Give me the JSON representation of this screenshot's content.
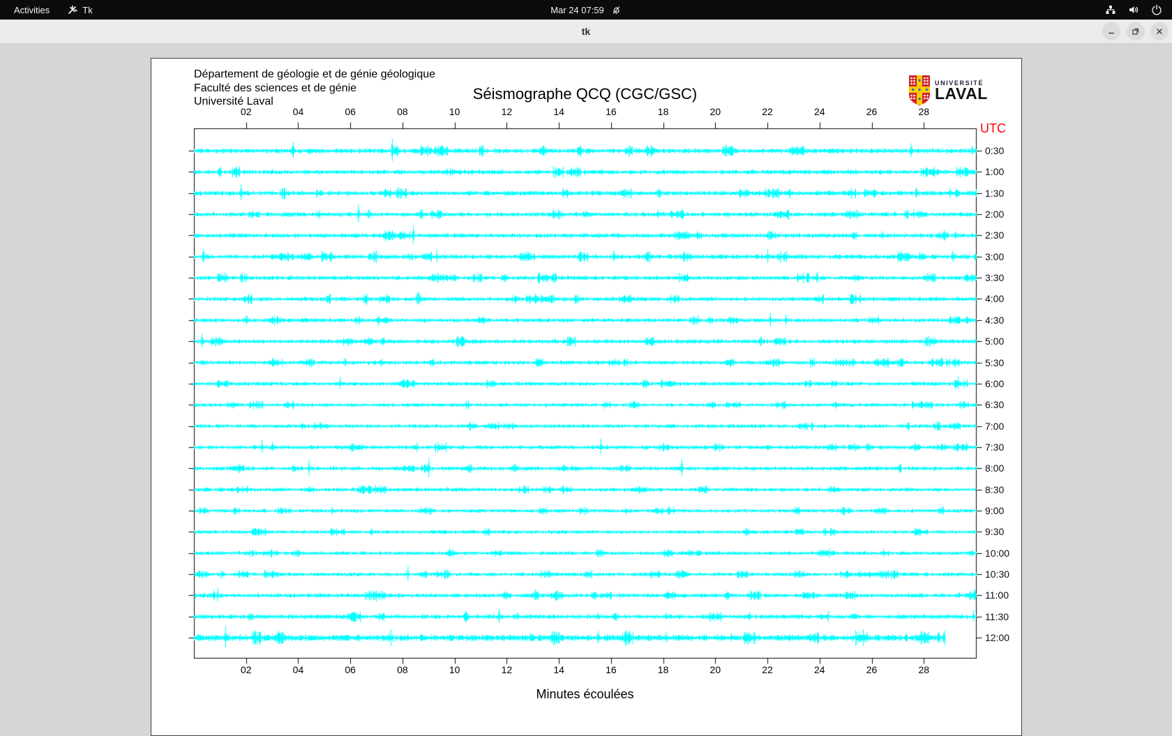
{
  "topbar": {
    "activities": "Activities",
    "app_name": "Tk",
    "clock": "Mar 24 07:59"
  },
  "titlebar": {
    "title": "tk"
  },
  "page": {
    "institution_lines": [
      "Département de géologie et de génie géologique",
      "Faculté des sciences et de génie",
      "Université Laval"
    ],
    "logo": {
      "line1": "UNIVERSITÉ",
      "line2": "LAVAL"
    },
    "utc_label": "UTC"
  },
  "colors": {
    "trace": "#00ffff",
    "utc_red": "#fb0007",
    "axis": "#000000",
    "logo_red": "#d2232a",
    "logo_yellow": "#ffcb05",
    "logo_blue": "#1f6fb4"
  },
  "chart_data": {
    "type": "line",
    "title": "Séismographe QCQ (CGC/GSC)",
    "xlabel": "Minutes écoulées",
    "x_range": [
      0,
      30
    ],
    "x_ticks": [
      "02",
      "04",
      "06",
      "08",
      "10",
      "12",
      "14",
      "16",
      "18",
      "20",
      "22",
      "24",
      "26",
      "28"
    ],
    "x_tick_minutes": [
      2,
      4,
      6,
      8,
      10,
      12,
      14,
      16,
      18,
      20,
      22,
      24,
      26,
      28
    ],
    "legend_right_header": "UTC",
    "rows": [
      {
        "label": "0:30",
        "noise": 1.9,
        "end": 30,
        "spikes": [
          [
            3.8,
            17
          ],
          [
            7.6,
            20
          ],
          [
            22.2,
            3
          ],
          [
            27.5,
            19
          ],
          [
            29.85,
            11
          ]
        ]
      },
      {
        "label": "1:00",
        "noise": 1.7,
        "end": 30,
        "spikes": [
          [
            15.6,
            4
          ],
          [
            21.4,
            5
          ],
          [
            23.0,
            3
          ]
        ]
      },
      {
        "label": "1:30",
        "noise": 1.8,
        "end": 30,
        "spikes": [
          [
            1.8,
            13
          ],
          [
            27.7,
            12
          ],
          [
            29.0,
            9
          ]
        ]
      },
      {
        "label": "2:00",
        "noise": 1.7,
        "end": 30,
        "spikes": [
          [
            6.3,
            15
          ],
          [
            6.7,
            13
          ],
          [
            14.0,
            5
          ],
          [
            17.8,
            11
          ],
          [
            18.7,
            8
          ],
          [
            27.6,
            7
          ]
        ]
      },
      {
        "label": "2:30",
        "noise": 1.7,
        "end": 30,
        "spikes": [
          [
            8.4,
            15
          ],
          [
            26.4,
            9
          ],
          [
            29.2,
            8
          ]
        ]
      },
      {
        "label": "3:00",
        "noise": 1.8,
        "end": 30,
        "spikes": [
          [
            0.35,
            15
          ],
          [
            9.3,
            13
          ],
          [
            16.1,
            11
          ],
          [
            22.0,
            11
          ],
          [
            29.1,
            12
          ]
        ]
      },
      {
        "label": "3:30",
        "noise": 1.6,
        "end": 30,
        "spikes": [
          [
            23.9,
            11
          ]
        ]
      },
      {
        "label": "4:00",
        "noise": 1.6,
        "end": 30,
        "spikes": [
          [
            8.6,
            13,
            4
          ]
        ]
      },
      {
        "label": "4:30",
        "noise": 1.5,
        "end": 30,
        "spikes": [
          [
            2.0,
            11
          ],
          [
            22.1,
            11
          ],
          [
            22.7,
            9
          ]
        ]
      },
      {
        "label": "5:00",
        "noise": 1.6,
        "end": 30,
        "spikes": [
          [
            0.3,
            13
          ]
        ]
      },
      {
        "label": "5:30",
        "noise": 1.5,
        "end": 30,
        "spikes": [
          [
            5.8,
            11
          ]
        ]
      },
      {
        "label": "6:00",
        "noise": 1.5,
        "end": 30,
        "spikes": [
          [
            5.6,
            11
          ],
          [
            29.3,
            11
          ]
        ]
      },
      {
        "label": "6:30",
        "noise": 1.3,
        "end": 30,
        "spikes": []
      },
      {
        "label": "7:00",
        "noise": 1.4,
        "end": 30,
        "spikes": []
      },
      {
        "label": "7:30",
        "noise": 1.5,
        "end": 30,
        "spikes": [
          [
            2.6,
            11
          ],
          [
            3.0,
            12
          ],
          [
            15.6,
            13
          ]
        ]
      },
      {
        "label": "8:00",
        "noise": 1.5,
        "end": 30,
        "spikes": [
          [
            4.4,
            13
          ],
          [
            9.0,
            15
          ],
          [
            12.3,
            8,
            6
          ],
          [
            18.7,
            15
          ]
        ]
      },
      {
        "label": "8:30",
        "noise": 1.4,
        "end": 30,
        "spikes": [
          [
            9.7,
            4
          ]
        ]
      },
      {
        "label": "9:00",
        "noise": 1.3,
        "end": 30,
        "spikes": []
      },
      {
        "label": "9:30",
        "noise": 1.3,
        "end": 30,
        "spikes": []
      },
      {
        "label": "10:00",
        "noise": 1.3,
        "end": 30,
        "spikes": []
      },
      {
        "label": "10:30",
        "noise": 1.4,
        "end": 30,
        "spikes": [
          [
            8.2,
            12
          ]
        ]
      },
      {
        "label": "11:00",
        "noise": 1.6,
        "end": 30,
        "spikes": [
          [
            0.9,
            13
          ],
          [
            13.1,
            15
          ],
          [
            29.95,
            13
          ]
        ]
      },
      {
        "label": "11:30",
        "noise": 1.7,
        "end": 30,
        "spikes": [
          [
            11.7,
            15
          ],
          [
            12.4,
            9
          ],
          [
            15.5,
            7
          ],
          [
            18.1,
            7
          ],
          [
            21.3,
            7
          ],
          [
            25.3,
            6,
            8
          ],
          [
            29.9,
            10
          ]
        ]
      },
      {
        "label": "12:00",
        "noise": 2.6,
        "end": 28.8,
        "spikes": [
          [
            0.15,
            6,
            5
          ],
          [
            1.2,
            17
          ],
          [
            10.25,
            5,
            6
          ],
          [
            12.9,
            9
          ],
          [
            15.5,
            11
          ],
          [
            18.1,
            9
          ],
          [
            20.6,
            7
          ],
          [
            25.8,
            11
          ],
          [
            27.3,
            7
          ],
          [
            28.0,
            9
          ],
          [
            28.55,
            13
          ]
        ]
      }
    ]
  }
}
